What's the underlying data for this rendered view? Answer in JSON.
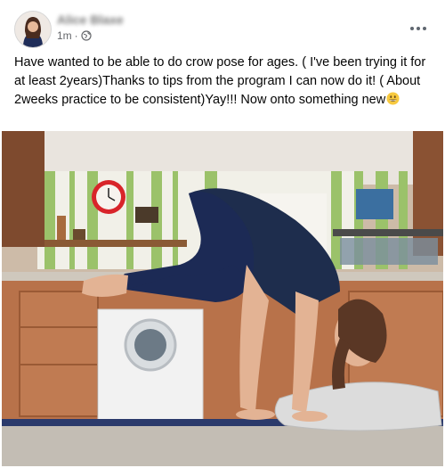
{
  "post": {
    "author_name": "Alice Blaxe",
    "time": "1m",
    "separator": "·",
    "audience_icon": "globe-icon",
    "more_icon": "more-horizontal-icon",
    "text": "Have wanted to be able to do crow pose for ages. ( I've been trying it for at least 2years)Thanks to tips  from the program I can now do it! ( About 2weeks practice to be consistent)Yay!!! Now onto something new",
    "emoji": "grinning-face-emoji"
  },
  "colors": {
    "wall_stripe_green": "#9bc26a",
    "wall_stripe_white": "#f1f0e8",
    "cabinet_wood": "#b8724a",
    "leggings": "#1c2a55",
    "shirt": "#1e2d4d",
    "clock": "#d8242a"
  }
}
